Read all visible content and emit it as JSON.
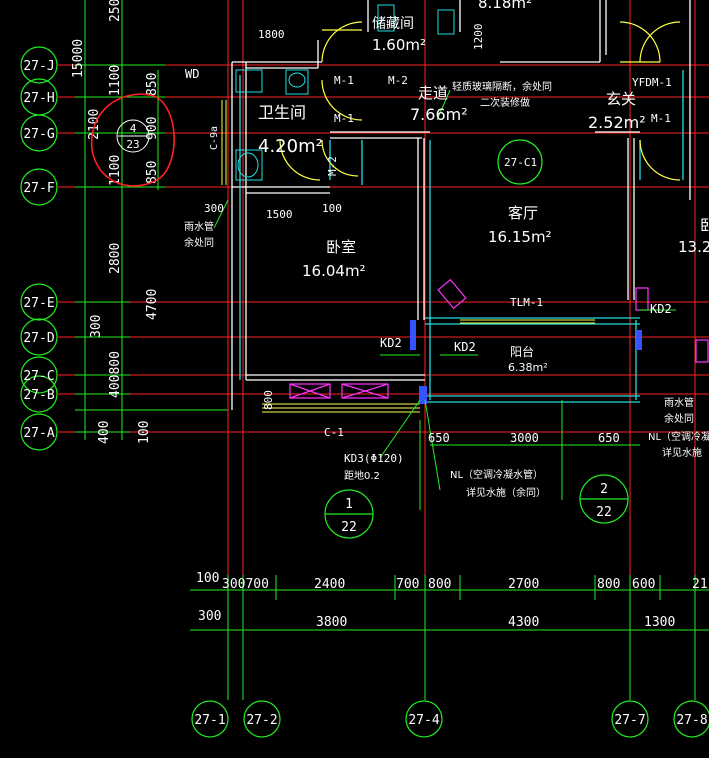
{
  "colors": {
    "grid_red": "#ff2222",
    "green": "#22ee22",
    "white": "#ffffff",
    "cyan": "#22dddd",
    "yellow": "#ffff44",
    "magenta": "#ff33ff",
    "blue": "#3355ff",
    "annotation_red": "#ff2020"
  },
  "axes_left": [
    "27-J",
    "27-H",
    "27-G",
    "27-F",
    "27-E",
    "27-D",
    "27-C",
    "27-B",
    "27-A"
  ],
  "axes_bottom": [
    "27-1",
    "27-2",
    "27-4",
    "27-7",
    "27-8"
  ],
  "left_dims": {
    "top_partial": "250",
    "total": "15000",
    "d1100a": "1100",
    "d850a": "850",
    "d900": "900",
    "d2100": "2100",
    "d1100b": "1100",
    "d850b": "850",
    "d2800": "2800",
    "d4700": "4700",
    "d300": "300",
    "d400800": "400800",
    "d400": "400",
    "d400b": "400",
    "d100": "100"
  },
  "circle_annotation": {
    "num": "4",
    "den": "23"
  },
  "rooms": {
    "storage": {
      "name": "储藏间",
      "area": "1.60m²"
    },
    "storage_top": {
      "area": "8.18m²"
    },
    "bathroom": {
      "name": "卫生间",
      "area": "4.20m²"
    },
    "corridor": {
      "name": "走道",
      "area": "7.66m²"
    },
    "foyer": {
      "name": "玄关",
      "area": "2.52m²"
    },
    "living": {
      "name": "客厅",
      "area": "16.15m²"
    },
    "bedroom": {
      "name": "卧室",
      "area": "16.04m²"
    },
    "balcony": {
      "name": "阳台",
      "area": "6.38m²"
    },
    "right_room": {
      "name_partial": "卧",
      "area_partial": "13.2"
    }
  },
  "labels": {
    "d1800": "1800",
    "wd": "WD",
    "c9": "C-9a",
    "m1a": "M-1",
    "m2a": "M-2",
    "m1b": "M-1",
    "m2b": "M-2",
    "m1c": "M-1",
    "yfdm": "YFDM-1",
    "glass_note1": "轻质玻璃隔断，余处同",
    "glass_note2": "二次装修做",
    "d1200": "1200",
    "axis_c1": "27-C1",
    "d300n": "300",
    "rain1": "雨水管",
    "rain2": "余处同",
    "d1500": "1500",
    "d100n": "100",
    "tlm": "TLM-1",
    "kd2a": "KD2",
    "kd2b": "KD2",
    "kd2c": "KD2",
    "d800v": "800",
    "c1": "C-1",
    "kd3": "KD3(Φ120)",
    "kd3b": "距地0.2",
    "nl1": "NL（空调冷凝水管）",
    "nl2": "详见水施（余同）",
    "d650a": "650",
    "d3000": "3000",
    "d650b": "650",
    "rr1": "雨水管",
    "rr2": "余处同",
    "rr3": "NL（空调冷凝",
    "rr4": "详见水施（余",
    "ref1_num": "1",
    "ref1_den": "22",
    "ref2_num": "2",
    "ref2_den": "22",
    "b100": "100",
    "b300": "300",
    "b300700": "300700",
    "b2400": "2400",
    "b700": "700",
    "b800a": "800",
    "b2700": "2700",
    "b800b": "800",
    "b600": "600",
    "b21": "21",
    "b3800": "3800",
    "b4300": "4300",
    "b1300": "1300"
  }
}
